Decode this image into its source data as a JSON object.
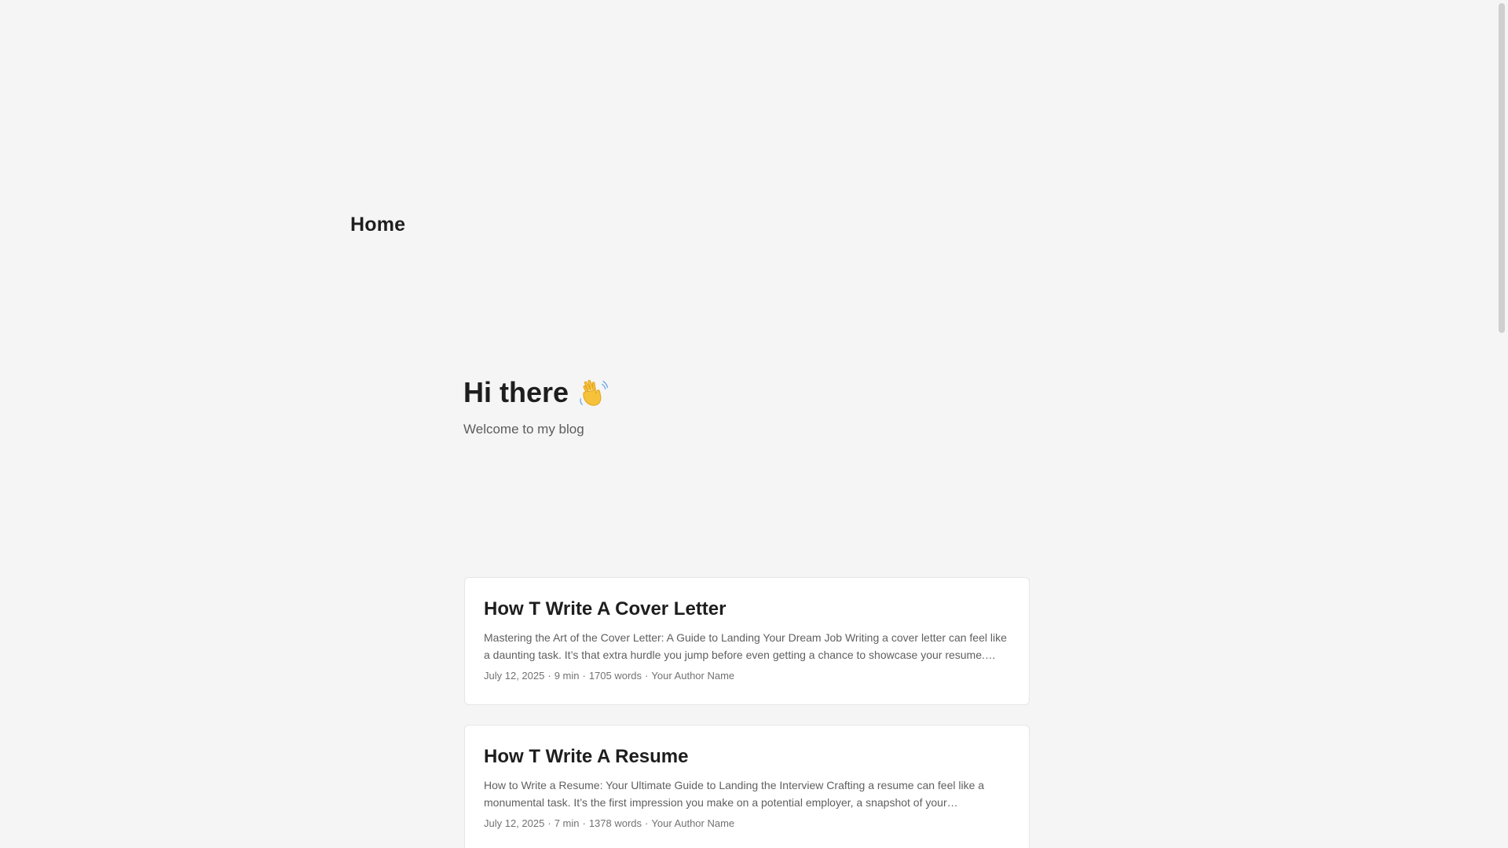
{
  "nav": {
    "home_label": "Home"
  },
  "intro": {
    "title": "Hi there",
    "subtitle": "Welcome to my blog",
    "icon": "waving-hand-icon"
  },
  "posts": [
    {
      "title": "How T Write A Cover Letter",
      "excerpt": "Mastering the Art of the Cover Letter: A Guide to Landing Your Dream Job Writing a cover letter can feel like a daunting task. It’s that extra hurdle you jump before even getting a chance to showcase your resume. But…",
      "date": "July 12, 2025",
      "read_time": "9 min",
      "words": "1705 words",
      "author": "Your Author Name",
      "sep": "·"
    },
    {
      "title": "How T Write A Resume",
      "excerpt": "How to Write a Resume: Your Ultimate Guide to Landing the Interview Crafting a resume can feel like a monumental task. It’s the first impression you make on a potential employer, a snapshot of your…",
      "date": "July 12, 2025",
      "read_time": "7 min",
      "words": "1378 words",
      "author": "Your Author Name",
      "sep": "·"
    }
  ],
  "colors": {
    "background": "#f5f5f5",
    "card": "#ffffff",
    "text_primary": "#1e1e1e",
    "text_secondary": "#5f5f5f"
  }
}
